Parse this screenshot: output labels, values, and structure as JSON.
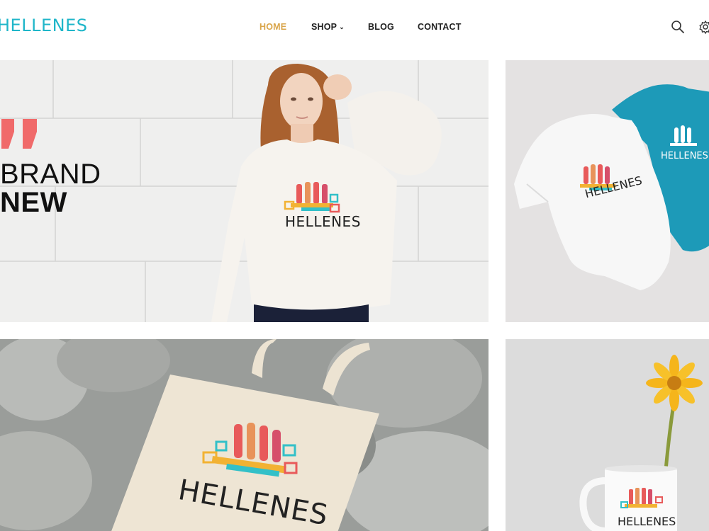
{
  "header": {
    "logo": "HELLENES",
    "nav": {
      "home": "HOME",
      "shop": "SHOP",
      "blog": "BLOG",
      "contact": "CONTACT"
    },
    "icons": [
      "search-icon",
      "settings-icon",
      "chevron-down-icon"
    ]
  },
  "hero": {
    "line1": "BRAND",
    "line2": "NEW",
    "shirt_logo": "HELLENES"
  },
  "products": {
    "baby_logo_white": "HELLENES",
    "baby_logo_blue": "HELLENES",
    "tote_logo": "HELLENES",
    "mug_logo": "HELLENES"
  },
  "colors": {
    "brand": "#1fb6c9",
    "nav_active": "#d9a54a",
    "quote": "#f06a6a"
  }
}
